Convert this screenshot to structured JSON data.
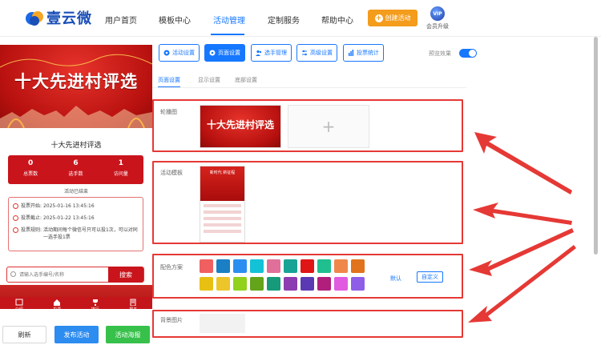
{
  "header": {
    "brand": "壹云微",
    "nav": [
      "用户首页",
      "模板中心",
      "活动管理",
      "定制服务",
      "帮助中心"
    ],
    "create_label": "创建活动",
    "vip_badge": "VIP",
    "vip_label": "会员升级"
  },
  "preview": {
    "banner_title": "十大先进村评选",
    "title": "十大先进村评选",
    "stats": [
      {
        "value": "0",
        "label": "总票数"
      },
      {
        "value": "6",
        "label": "选手数"
      },
      {
        "value": "1",
        "label": "访问量"
      }
    ],
    "status": "活动已结束",
    "info": [
      {
        "label": "投票开始:",
        "value": "2025-01-16 13:45:16"
      },
      {
        "label": "投票截止:",
        "value": "2025-01-22 13:45:16"
      },
      {
        "label": "投票规则:",
        "value": "活动期间每个微信号只可以投1次，可以对同一选手投1票"
      }
    ],
    "search_placeholder": "请输入选手编号/名称",
    "search_button": "搜索",
    "tabs": [
      "介绍",
      "投票",
      "排行",
      "报名"
    ]
  },
  "bottom_buttons": {
    "refresh": "刷新",
    "publish": "发布活动",
    "qrcode": "活动海报"
  },
  "toolbar": {
    "buttons": [
      "活动设置",
      "页面设置",
      "选手管理",
      "高级设置",
      "投票统计"
    ],
    "active": "页面设置",
    "preview_label": "预览效果"
  },
  "subtabs": [
    "页面设置",
    "显示设置",
    "底部设置"
  ],
  "sections": {
    "carousel_label": "轮播图",
    "carousel_image_title": "十大先进村评选",
    "upload_symbol": "+",
    "template_label": "活动模板",
    "template_title": "新时代 新征程",
    "color_label": "配色方案",
    "color_default": "默认",
    "color_custom": "自定义",
    "colors_row1": [
      "#f06060",
      "#1a7fc4",
      "#2a8ff0",
      "#13c2d6",
      "#e0709a",
      "#17a395",
      "#e01515",
      "#1fbf8f",
      "#f0874a",
      "#e0731c"
    ],
    "colors_row2": [
      "#e8c013",
      "#ecc52a",
      "#8fd11c",
      "#63a41a",
      "#169a7a",
      "#8c3bb0",
      "#5a3ab2",
      "#b01f7c",
      "#e05be0",
      "#8f5ee8"
    ],
    "bg_label": "背景图片"
  },
  "colors": {
    "accent": "#1677ff",
    "highlight": "#e53935",
    "banner_red": "#c9141c",
    "create_orange": "#f49c1c"
  }
}
